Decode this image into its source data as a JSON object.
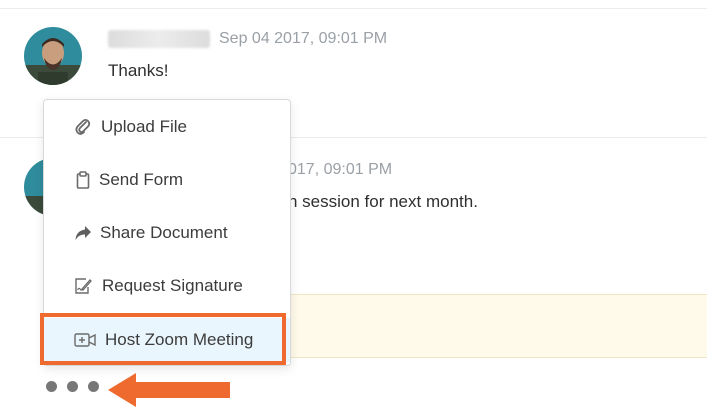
{
  "messages": [
    {
      "timestamp": "Sep 04 2017, 09:01 PM",
      "text": "Thanks!"
    },
    {
      "timestamp_partial": "017, 09:01 PM",
      "text_partial": "n session for next month."
    }
  ],
  "menu": {
    "items": [
      {
        "label": "Upload File",
        "icon": "paperclip-icon"
      },
      {
        "label": "Send Form",
        "icon": "clipboard-icon"
      },
      {
        "label": "Share Document",
        "icon": "share-arrow-icon"
      },
      {
        "label": "Request Signature",
        "icon": "signature-icon"
      },
      {
        "label": "Host Zoom Meeting",
        "icon": "video-camera-icon"
      }
    ],
    "highlighted_item": "Host Zoom Meeting"
  },
  "more_options": {
    "icon": "more-dots-icon"
  },
  "colors": {
    "highlight_outline": "#ee6a2f",
    "arrow": "#ee6a2f",
    "menu_highlight_bg": "#e9f6fd",
    "compose_bg": "#fffaea"
  }
}
